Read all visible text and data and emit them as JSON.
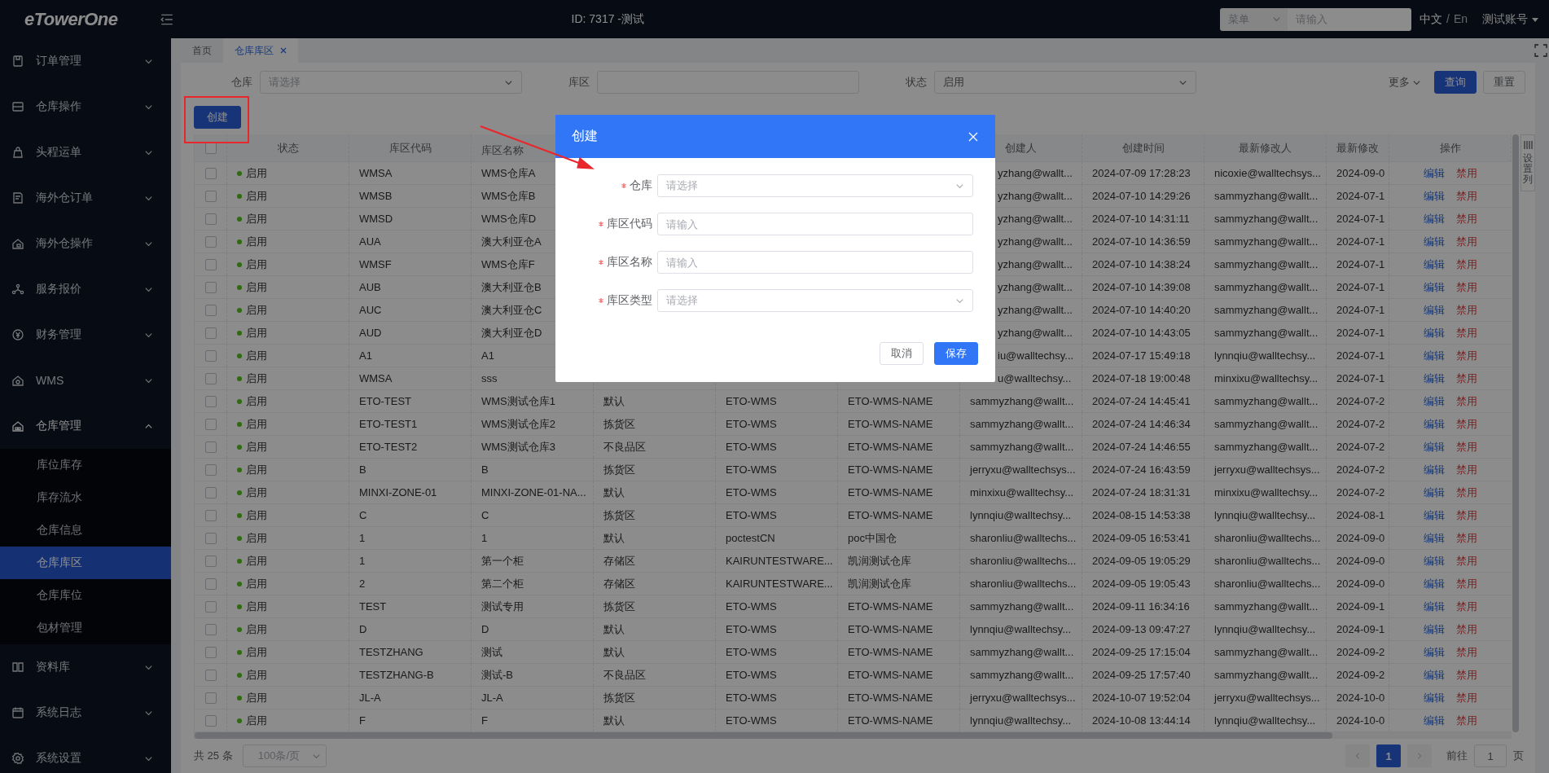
{
  "top_bar": {
    "logo": "eTowerOne",
    "title": "ID: 7317 -测试",
    "search_scope": "菜单",
    "search": {
      "placeholder": "请输入"
    },
    "languages": [
      {
        "label": "中文",
        "selected": true
      },
      {
        "label": "En",
        "selected": false
      }
    ],
    "language_separator": "/",
    "account": "测试账号"
  },
  "sidebar": {
    "items": [
      {
        "label": "订单管理",
        "expanded": false
      },
      {
        "label": "仓库操作",
        "expanded": false
      },
      {
        "label": "头程运单",
        "expanded": false
      },
      {
        "label": "海外仓订单",
        "expanded": false
      },
      {
        "label": "海外仓操作",
        "expanded": false
      },
      {
        "label": "服务报价",
        "expanded": false
      },
      {
        "label": "财务管理",
        "expanded": false
      },
      {
        "label": "WMS",
        "expanded": false
      },
      {
        "label": "仓库管理",
        "expanded": true,
        "children": [
          {
            "label": "库位库存",
            "selected": false
          },
          {
            "label": "库存流水",
            "selected": false
          },
          {
            "label": "仓库信息",
            "selected": false
          },
          {
            "label": "仓库库区",
            "selected": true
          },
          {
            "label": "仓库库位",
            "selected": false
          },
          {
            "label": "包材管理",
            "selected": false
          }
        ]
      },
      {
        "label": "资料库",
        "expanded": false
      },
      {
        "label": "系统日志",
        "expanded": false
      },
      {
        "label": "系统设置",
        "expanded": false
      }
    ]
  },
  "tabs": [
    {
      "label": "首页",
      "selected": false,
      "closable": false
    },
    {
      "label": "仓库库区",
      "selected": true,
      "closable": true
    }
  ],
  "filters": [
    {
      "label": "仓库",
      "kind": "select",
      "placeholder": "请选择"
    },
    {
      "label": "库区",
      "kind": "input"
    },
    {
      "label": "状态",
      "kind": "select",
      "value": "启用"
    }
  ],
  "more": "更多",
  "search_button": "查询",
  "reset_button": "重置",
  "create_button": "创建",
  "column_settings": "设置列",
  "table": {
    "select_all": {
      "checked": false
    },
    "columns": [
      "状态",
      "库区代码",
      "库区名称",
      null,
      null,
      null,
      "创建人",
      "创建时间",
      "最新修改人",
      "最新修改",
      "操作"
    ],
    "rows": [
      {
        "checked": false,
        "cells": [
          "启用",
          "WMSA",
          "WMS仓库A",
          null,
          null,
          null,
          "yzhang@wallt...",
          "2024-07-09 17:28:23",
          "nicoxie@walltechsys...",
          "2024-09-0"
        ],
        "actions": [
          "编辑",
          "禁用"
        ]
      },
      {
        "checked": false,
        "cells": [
          "启用",
          "WMSB",
          "WMS仓库B",
          null,
          null,
          null,
          "yzhang@wallt...",
          "2024-07-10 14:29:26",
          "sammyzhang@wallt...",
          "2024-07-1"
        ],
        "actions": [
          "编辑",
          "禁用"
        ]
      },
      {
        "checked": false,
        "cells": [
          "启用",
          "WMSD",
          "WMS仓库D",
          null,
          null,
          null,
          "yzhang@wallt...",
          "2024-07-10 14:31:11",
          "sammyzhang@wallt...",
          "2024-07-1"
        ],
        "actions": [
          "编辑",
          "禁用"
        ]
      },
      {
        "checked": false,
        "cells": [
          "启用",
          "AUA",
          "澳大利亚仓A",
          null,
          null,
          null,
          "yzhang@wallt...",
          "2024-07-10 14:36:59",
          "sammyzhang@wallt...",
          "2024-07-1"
        ],
        "actions": [
          "编辑",
          "禁用"
        ]
      },
      {
        "checked": false,
        "cells": [
          "启用",
          "WMSF",
          "WMS仓库F",
          null,
          null,
          null,
          "yzhang@wallt...",
          "2024-07-10 14:38:24",
          "sammyzhang@wallt...",
          "2024-07-1"
        ],
        "actions": [
          "编辑",
          "禁用"
        ]
      },
      {
        "checked": false,
        "cells": [
          "启用",
          "AUB",
          "澳大利亚仓B",
          null,
          null,
          null,
          "yzhang@wallt...",
          "2024-07-10 14:39:08",
          "sammyzhang@wallt...",
          "2024-07-1"
        ],
        "actions": [
          "编辑",
          "禁用"
        ]
      },
      {
        "checked": false,
        "cells": [
          "启用",
          "AUC",
          "澳大利亚仓C",
          null,
          null,
          null,
          "yzhang@wallt...",
          "2024-07-10 14:40:20",
          "sammyzhang@wallt...",
          "2024-07-1"
        ],
        "actions": [
          "编辑",
          "禁用"
        ]
      },
      {
        "checked": false,
        "cells": [
          "启用",
          "AUD",
          "澳大利亚仓D",
          null,
          null,
          null,
          "yzhang@wallt...",
          "2024-07-10 14:43:05",
          "sammyzhang@wallt...",
          "2024-07-1"
        ],
        "actions": [
          "编辑",
          "禁用"
        ]
      },
      {
        "checked": false,
        "cells": [
          "启用",
          "A1",
          "A1",
          null,
          null,
          null,
          "iu@walltechsy...",
          "2024-07-17 15:49:18",
          "lynnqiu@walltechsy...",
          "2024-07-1"
        ],
        "actions": [
          "编辑",
          "禁用"
        ]
      },
      {
        "checked": false,
        "cells": [
          "启用",
          "WMSA",
          "sss",
          null,
          null,
          null,
          "u@walltechsy...",
          "2024-07-18 19:00:48",
          "minxixu@walltechsy...",
          "2024-07-1"
        ],
        "actions": [
          "编辑",
          "禁用"
        ]
      },
      {
        "checked": false,
        "cells": [
          "启用",
          "ETO-TEST",
          "WMS测试仓库1",
          "默认",
          "ETO-WMS",
          "ETO-WMS-NAME",
          "sammyzhang@wallt...",
          "2024-07-24 14:45:41",
          "sammyzhang@wallt...",
          "2024-07-2"
        ],
        "actions": [
          "编辑",
          "禁用"
        ]
      },
      {
        "checked": false,
        "cells": [
          "启用",
          "ETO-TEST1",
          "WMS测试仓库2",
          "拣货区",
          "ETO-WMS",
          "ETO-WMS-NAME",
          "sammyzhang@wallt...",
          "2024-07-24 14:46:34",
          "sammyzhang@wallt...",
          "2024-07-2"
        ],
        "actions": [
          "编辑",
          "禁用"
        ]
      },
      {
        "checked": false,
        "cells": [
          "启用",
          "ETO-TEST2",
          "WMS测试仓库3",
          "不良品区",
          "ETO-WMS",
          "ETO-WMS-NAME",
          "sammyzhang@wallt...",
          "2024-07-24 14:46:55",
          "sammyzhang@wallt...",
          "2024-07-2"
        ],
        "actions": [
          "编辑",
          "禁用"
        ]
      },
      {
        "checked": false,
        "cells": [
          "启用",
          "B",
          "B",
          "拣货区",
          "ETO-WMS",
          "ETO-WMS-NAME",
          "jerryxu@walltechsys...",
          "2024-07-24 16:43:59",
          "jerryxu@walltechsys...",
          "2024-07-2"
        ],
        "actions": [
          "编辑",
          "禁用"
        ]
      },
      {
        "checked": false,
        "cells": [
          "启用",
          "MINXI-ZONE-01",
          "MINXI-ZONE-01-NA...",
          "默认",
          "ETO-WMS",
          "ETO-WMS-NAME",
          "minxixu@walltechsy...",
          "2024-07-24 18:31:31",
          "minxixu@walltechsy...",
          "2024-07-2"
        ],
        "actions": [
          "编辑",
          "禁用"
        ]
      },
      {
        "checked": false,
        "cells": [
          "启用",
          "C",
          "C",
          "拣货区",
          "ETO-WMS",
          "ETO-WMS-NAME",
          "lynnqiu@walltechsy...",
          "2024-08-15 14:53:38",
          "lynnqiu@walltechsy...",
          "2024-08-1"
        ],
        "actions": [
          "编辑",
          "禁用"
        ]
      },
      {
        "checked": false,
        "cells": [
          "启用",
          "1",
          "1",
          "默认",
          "poctestCN",
          "poc中国仓",
          "sharonliu@walltechs...",
          "2024-09-05 16:53:41",
          "sharonliu@walltechs...",
          "2024-09-0"
        ],
        "actions": [
          "编辑",
          "禁用"
        ]
      },
      {
        "checked": false,
        "cells": [
          "启用",
          "1",
          "第一个柜",
          "存储区",
          "KAIRUNTESTWARE...",
          "凯润测试仓库",
          "sharonliu@walltechs...",
          "2024-09-05 19:05:29",
          "sharonliu@walltechs...",
          "2024-09-0"
        ],
        "actions": [
          "编辑",
          "禁用"
        ]
      },
      {
        "checked": false,
        "cells": [
          "启用",
          "2",
          "第二个柜",
          "存储区",
          "KAIRUNTESTWARE...",
          "凯润测试仓库",
          "sharonliu@walltechs...",
          "2024-09-05 19:05:43",
          "sharonliu@walltechs...",
          "2024-09-0"
        ],
        "actions": [
          "编辑",
          "禁用"
        ]
      },
      {
        "checked": false,
        "cells": [
          "启用",
          "TEST",
          "测试专用",
          "拣货区",
          "ETO-WMS",
          "ETO-WMS-NAME",
          "sammyzhang@wallt...",
          "2024-09-11 16:34:16",
          "sammyzhang@wallt...",
          "2024-09-1"
        ],
        "actions": [
          "编辑",
          "禁用"
        ]
      },
      {
        "checked": false,
        "cells": [
          "启用",
          "D",
          "D",
          "默认",
          "ETO-WMS",
          "ETO-WMS-NAME",
          "lynnqiu@walltechsy...",
          "2024-09-13 09:47:27",
          "lynnqiu@walltechsy...",
          "2024-09-1"
        ],
        "actions": [
          "编辑",
          "禁用"
        ]
      },
      {
        "checked": false,
        "cells": [
          "启用",
          "TESTZHANG",
          "测试",
          "默认",
          "ETO-WMS",
          "ETO-WMS-NAME",
          "sammyzhang@wallt...",
          "2024-09-25 17:15:04",
          "sammyzhang@wallt...",
          "2024-09-2"
        ],
        "actions": [
          "编辑",
          "禁用"
        ]
      },
      {
        "checked": false,
        "cells": [
          "启用",
          "TESTZHANG-B",
          "测试-B",
          "不良品区",
          "ETO-WMS",
          "ETO-WMS-NAME",
          "sammyzhang@wallt...",
          "2024-09-25 17:57:40",
          "sammyzhang@wallt...",
          "2024-09-2"
        ],
        "actions": [
          "编辑",
          "禁用"
        ]
      },
      {
        "checked": false,
        "cells": [
          "启用",
          "JL-A",
          "JL-A",
          "拣货区",
          "ETO-WMS",
          "ETO-WMS-NAME",
          "jerryxu@walltechsys...",
          "2024-10-07 19:52:04",
          "jerryxu@walltechsys...",
          "2024-10-0"
        ],
        "actions": [
          "编辑",
          "禁用"
        ]
      },
      {
        "checked": false,
        "cells": [
          "启用",
          "F",
          "F",
          "默认",
          "ETO-WMS",
          "ETO-WMS-NAME",
          "lynnqiu@walltechsy...",
          "2024-10-08 13:44:14",
          "lynnqiu@walltechsy...",
          "2024-10-0"
        ],
        "actions": [
          "编辑",
          "禁用"
        ]
      }
    ]
  },
  "pagination": {
    "total": "共 25 条",
    "page_size": "100条/页",
    "pages": [
      {
        "label": "1",
        "selected": true
      }
    ],
    "goto_label": "前往",
    "goto_value": "1",
    "page_suffix": "页"
  },
  "dialog": {
    "title": "创建",
    "fields": [
      {
        "label": "仓库",
        "required": true,
        "kind": "select",
        "placeholder": "请选择"
      },
      {
        "label": "库区代码",
        "required": true,
        "kind": "input",
        "placeholder": "请输入"
      },
      {
        "label": "库区名称",
        "required": true,
        "kind": "input",
        "placeholder": "请输入"
      },
      {
        "label": "库区类型",
        "required": true,
        "kind": "select",
        "placeholder": "请选择"
      }
    ],
    "buttons": [
      {
        "label": "取消",
        "kind": "secondary"
      },
      {
        "label": "保存",
        "kind": "primary"
      }
    ]
  }
}
